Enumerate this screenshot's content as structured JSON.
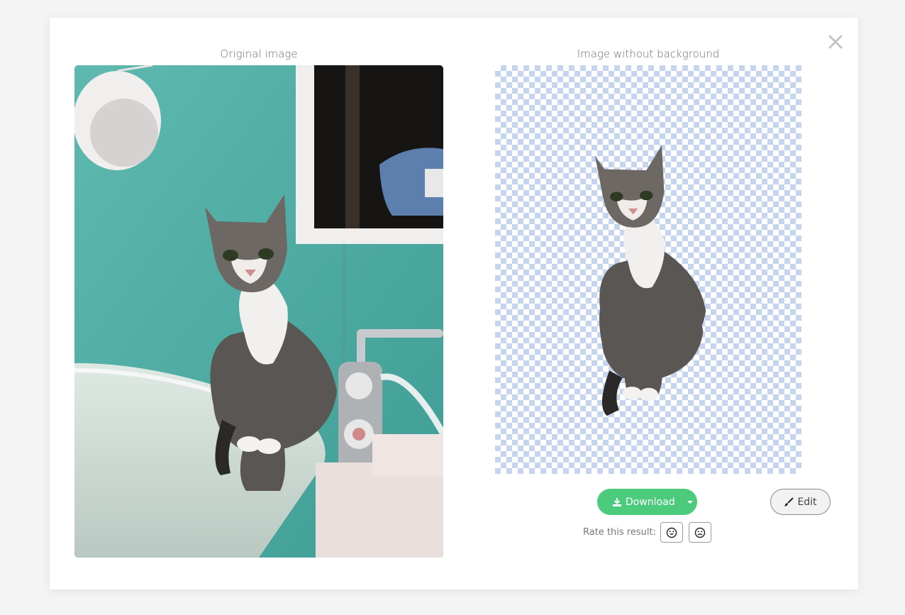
{
  "dialog": {
    "close_icon": "close-icon",
    "original_title": "Original image",
    "result_title": "Image without background"
  },
  "actions": {
    "download_label": "Download",
    "download_icon": "download-icon",
    "dropdown_icon": "caret-down-icon",
    "edit_label": "Edit",
    "edit_icon": "brush-icon"
  },
  "rating": {
    "label": "Rate this result:",
    "good_icon": "smile-icon",
    "bad_icon": "frown-icon"
  },
  "colors": {
    "download_bg": "#4dcb7d",
    "checker": "#c7d4ee",
    "wall": "#5fb6ac",
    "page_bg": "#f4f4f4"
  }
}
